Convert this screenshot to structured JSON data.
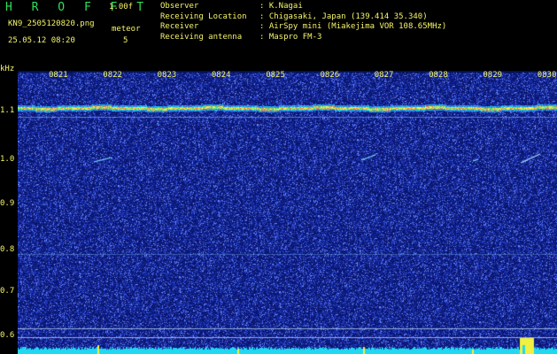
{
  "header": {
    "brand": "H R O F F T",
    "version": "1.00f",
    "filename": "KN9_2505120820.png",
    "datetime": "25.05.12 08:20",
    "meteor_label": "meteor",
    "meteor_count": "5",
    "meta": [
      {
        "key": "Observer",
        "value": ": K.Nagai"
      },
      {
        "key": "Receiving Location",
        "value": ": Chigasaki, Japan (139.414 35.340)"
      },
      {
        "key": "Receiver",
        "value": ": AirSpy mini (Miakejima VOR 108.65MHz)"
      },
      {
        "key": "Receiving antenna",
        "value": ": Maspro FM-3"
      }
    ]
  },
  "spectrogram": {
    "y_unit": "kHz",
    "y_ticks": [
      "1.1",
      "1.0",
      "0.9",
      "0.8",
      "0.7",
      "0.6"
    ],
    "time_ticks": [
      "0821",
      "0822",
      "0823",
      "0824",
      "0825",
      "0826",
      "0827",
      "0828",
      "0829",
      "0830"
    ],
    "colors": {
      "background": "#0b1a78",
      "noise": "#3f5fd8",
      "carrier": "#f0f040",
      "baseline": "#20d8f0",
      "text": "#f5f56a"
    }
  }
}
